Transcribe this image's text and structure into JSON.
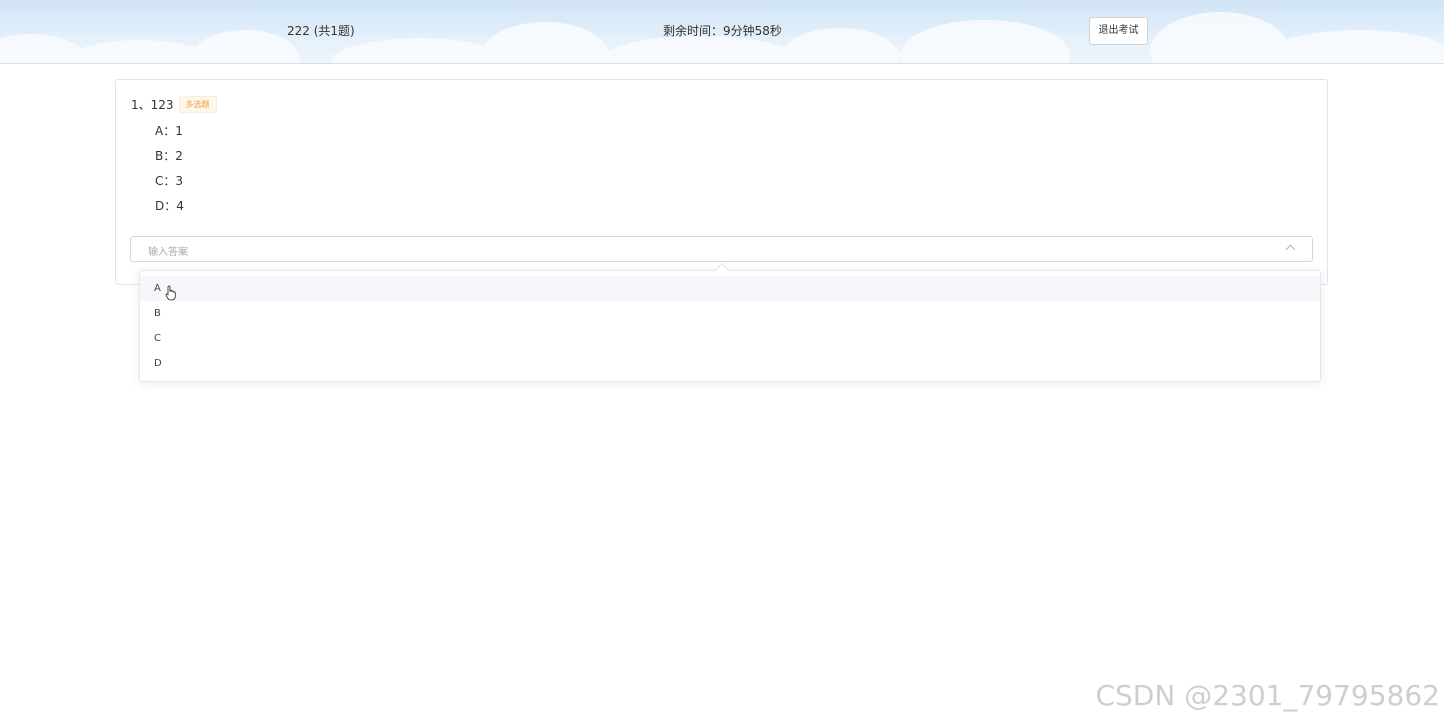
{
  "header": {
    "exam_title": "222 (共1题)",
    "timer_text": "剩余时间：9分钟58秒",
    "exit_label": "退出考试"
  },
  "question": {
    "number_title": "1、123",
    "type_tag": "多选题",
    "options": [
      {
        "label": "A：1"
      },
      {
        "label": "B：2"
      },
      {
        "label": "C：3"
      },
      {
        "label": "D：4"
      }
    ],
    "answer_placeholder": "输入答案"
  },
  "dropdown": {
    "items": [
      "A",
      "B",
      "C",
      "D"
    ],
    "hovered": "A"
  },
  "watermark": "CSDN @2301_79795862",
  "colors": {
    "tag_text": "#e6a23c",
    "tag_bg": "#fdf6ec",
    "header_sky": "#cfe4f6"
  }
}
